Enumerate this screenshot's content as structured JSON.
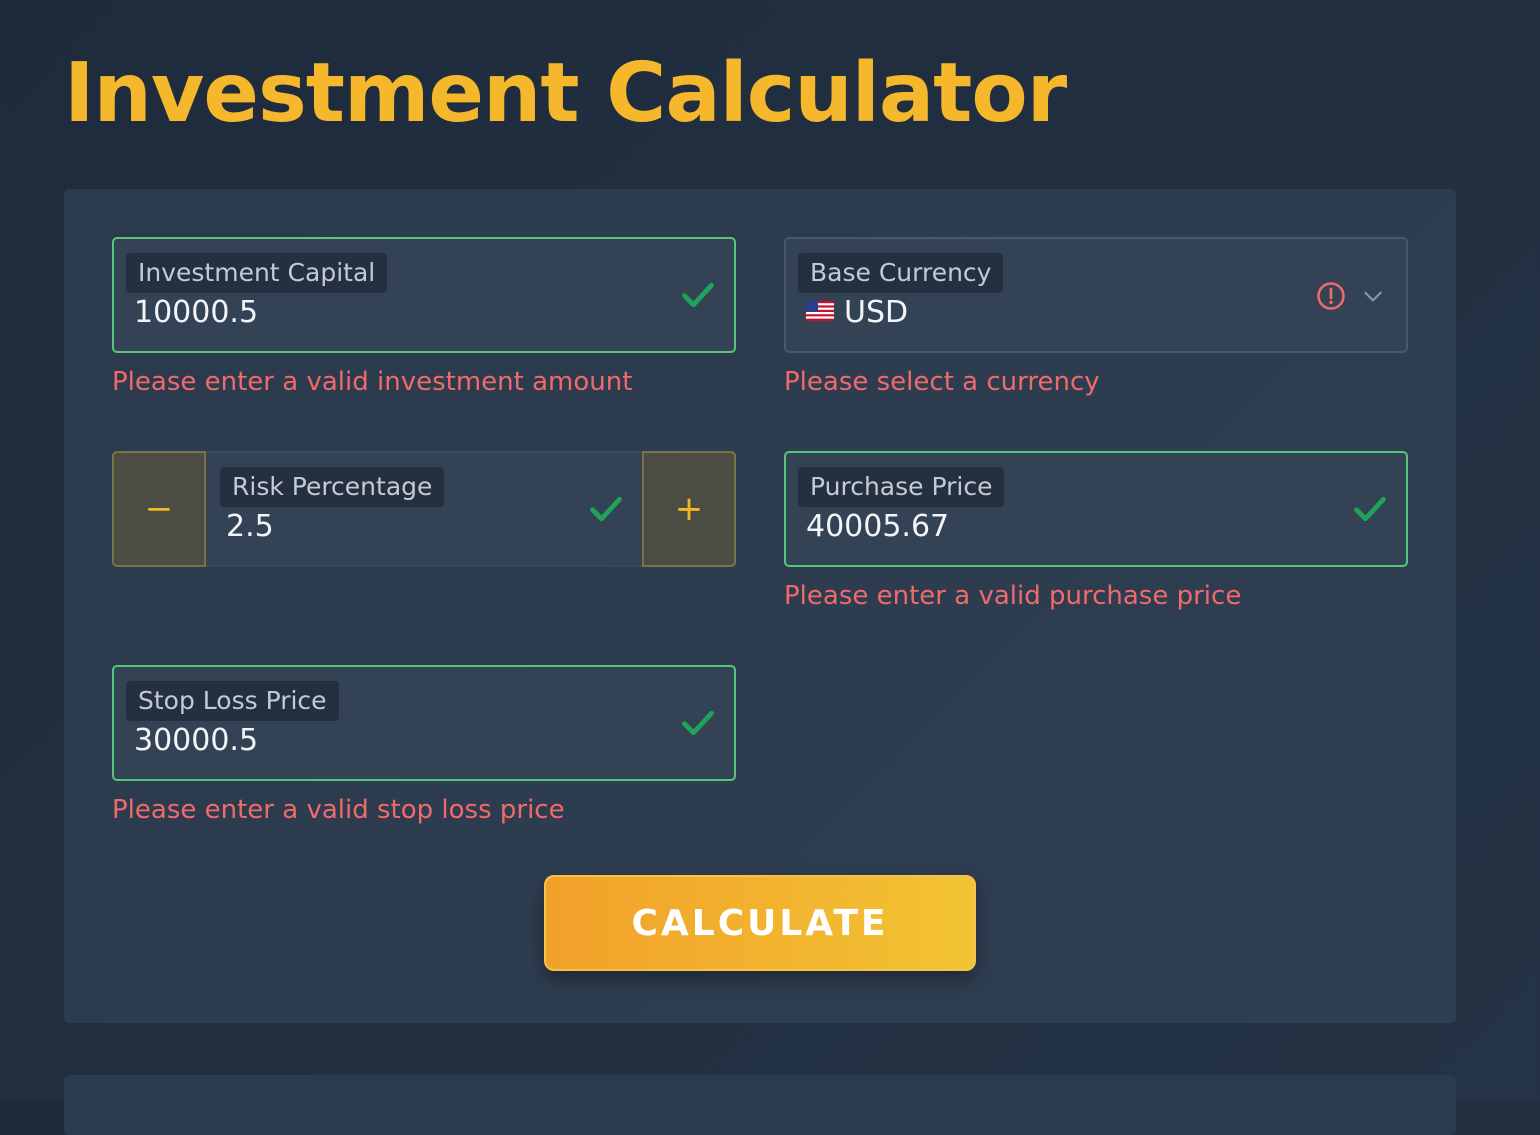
{
  "title": "Investment Calculator",
  "colors": {
    "accent": "#f5b72c",
    "valid": "#57c47c",
    "error": "#f06a6a",
    "background": "#1e2b3c"
  },
  "fields": {
    "investment_capital": {
      "label": "Investment Capital",
      "value": "10000.5",
      "error": "Please enter a valid investment amount",
      "status_icon": "check-icon"
    },
    "base_currency": {
      "label": "Base Currency",
      "value": "USD",
      "flag": "us-flag-icon",
      "error": "Please select a currency",
      "status_icon": "error-circle-icon"
    },
    "risk_percentage": {
      "label": "Risk Percentage",
      "value": "2.5",
      "decrement": "−",
      "increment": "+",
      "status_icon": "check-icon"
    },
    "purchase_price": {
      "label": "Purchase Price",
      "value": "40005.67",
      "error": "Please enter a valid purchase price",
      "status_icon": "check-icon"
    },
    "stop_loss_price": {
      "label": "Stop Loss Price",
      "value": "30000.5",
      "error": "Please enter a valid stop loss price",
      "status_icon": "check-icon"
    }
  },
  "calculate_button": "CALCULATE"
}
